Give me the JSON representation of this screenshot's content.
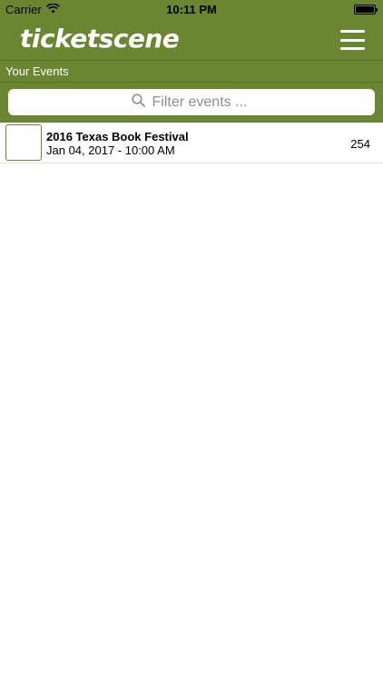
{
  "status_bar": {
    "carrier": "Carrier",
    "time": "10:11 PM",
    "battery_level": 1.0
  },
  "nav": {
    "logo_text": "ticketscene",
    "menu_icon": "hamburger-menu-icon"
  },
  "section": {
    "title": "Your Events"
  },
  "search": {
    "placeholder": "Filter events ...",
    "value": "",
    "icon": "search-icon"
  },
  "events": [
    {
      "title": "2016 Texas Book Festival",
      "date": "Jan 04, 2017 - 10:00 AM",
      "count": "254"
    }
  ],
  "colors": {
    "brand_green": "#6b8631",
    "row_divider": "#e3e3e3"
  }
}
